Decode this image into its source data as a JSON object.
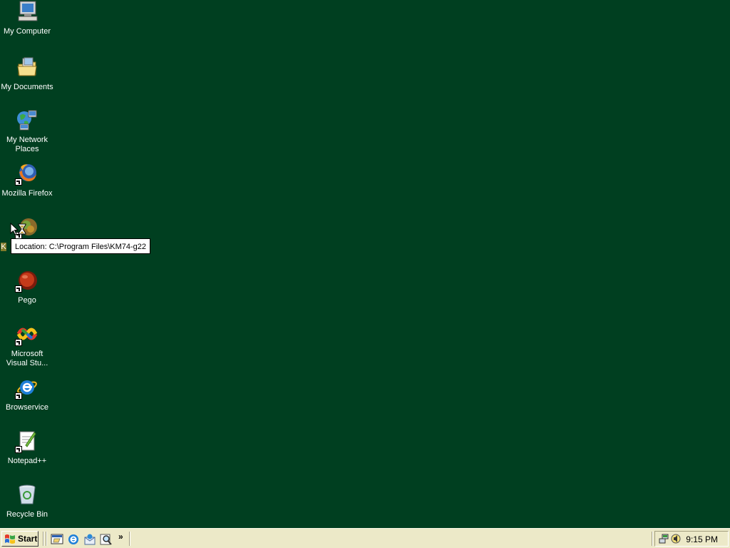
{
  "desktop_icons": [
    {
      "label": "My Computer",
      "icon": "my-computer-icon"
    },
    {
      "label": "My Documents",
      "icon": "my-documents-icon"
    },
    {
      "label": "My Network Places",
      "icon": "network-places-icon"
    },
    {
      "label": "Mozilla Firefox",
      "icon": "firefox-icon"
    },
    {
      "label": "K",
      "icon": "km74-app-icon"
    },
    {
      "label": "Pego",
      "icon": "pego-icon"
    },
    {
      "label": "Microsoft Visual Stu...",
      "icon": "visual-studio-icon"
    },
    {
      "label": "Browservice",
      "icon": "internet-explorer-icon"
    },
    {
      "label": "Notepad++",
      "icon": "notepadpp-icon"
    },
    {
      "label": "Recycle Bin",
      "icon": "recycle-bin-icon"
    }
  ],
  "tooltip": {
    "text": "Location: C:\\Program Files\\KM74-g22"
  },
  "taskbar": {
    "start_label": "Start",
    "quick_launch": [
      "show-desktop-icon",
      "internet-explorer-icon",
      "outlook-express-icon",
      "search-icon"
    ],
    "chevron": "»",
    "clock": "9:15 PM",
    "tray_icons": [
      "network-icon",
      "volume-icon"
    ]
  },
  "colors": {
    "desktop": "#003f20",
    "taskbar": "#ece9c8"
  }
}
